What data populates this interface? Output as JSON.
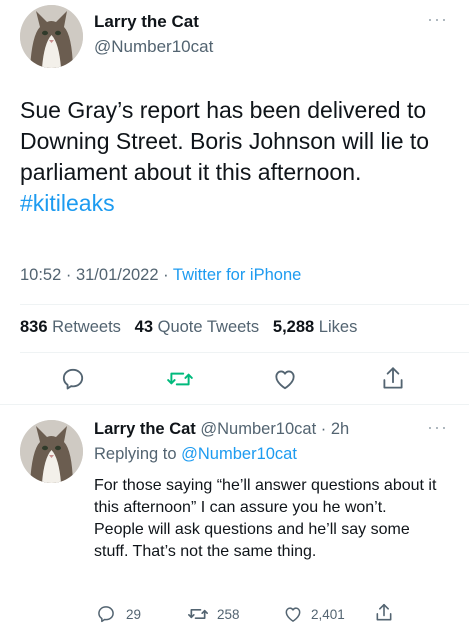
{
  "tweet": {
    "author_name": "Larry the Cat",
    "author_handle": "@Number10cat",
    "more_icon": "more-icon",
    "text_main": "Sue Gray’s report has been delivered to Downing Street. Boris Johnson will lie to parliament about it this afternoon. ",
    "hashtag": "#kitileaks",
    "time": "10:52 · 31/01/2022 · ",
    "source": "Twitter for iPhone",
    "retweets_count": "836",
    "retweets_label": "Retweets",
    "quotes_count": "43",
    "quotes_label": "Quote Tweets",
    "likes_count": "5,288",
    "likes_label": "Likes"
  },
  "reply": {
    "author_name": "Larry the Cat",
    "author_handle": "@Number10cat · 2h",
    "replying_label": "Replying to ",
    "replying_handle": "@Number10cat",
    "text": "For those saying “he’ll answer questions about it this afternoon” I can assure you he won’t. People will ask questions and he’ll say some stuff. That’s not the same thing.",
    "reply_count": "29",
    "retweet_count": "258",
    "like_count": "2,401"
  },
  "colors": {
    "accent": "#1d9bf0",
    "retweet_green": "#00ba7c",
    "muted": "#536471"
  }
}
